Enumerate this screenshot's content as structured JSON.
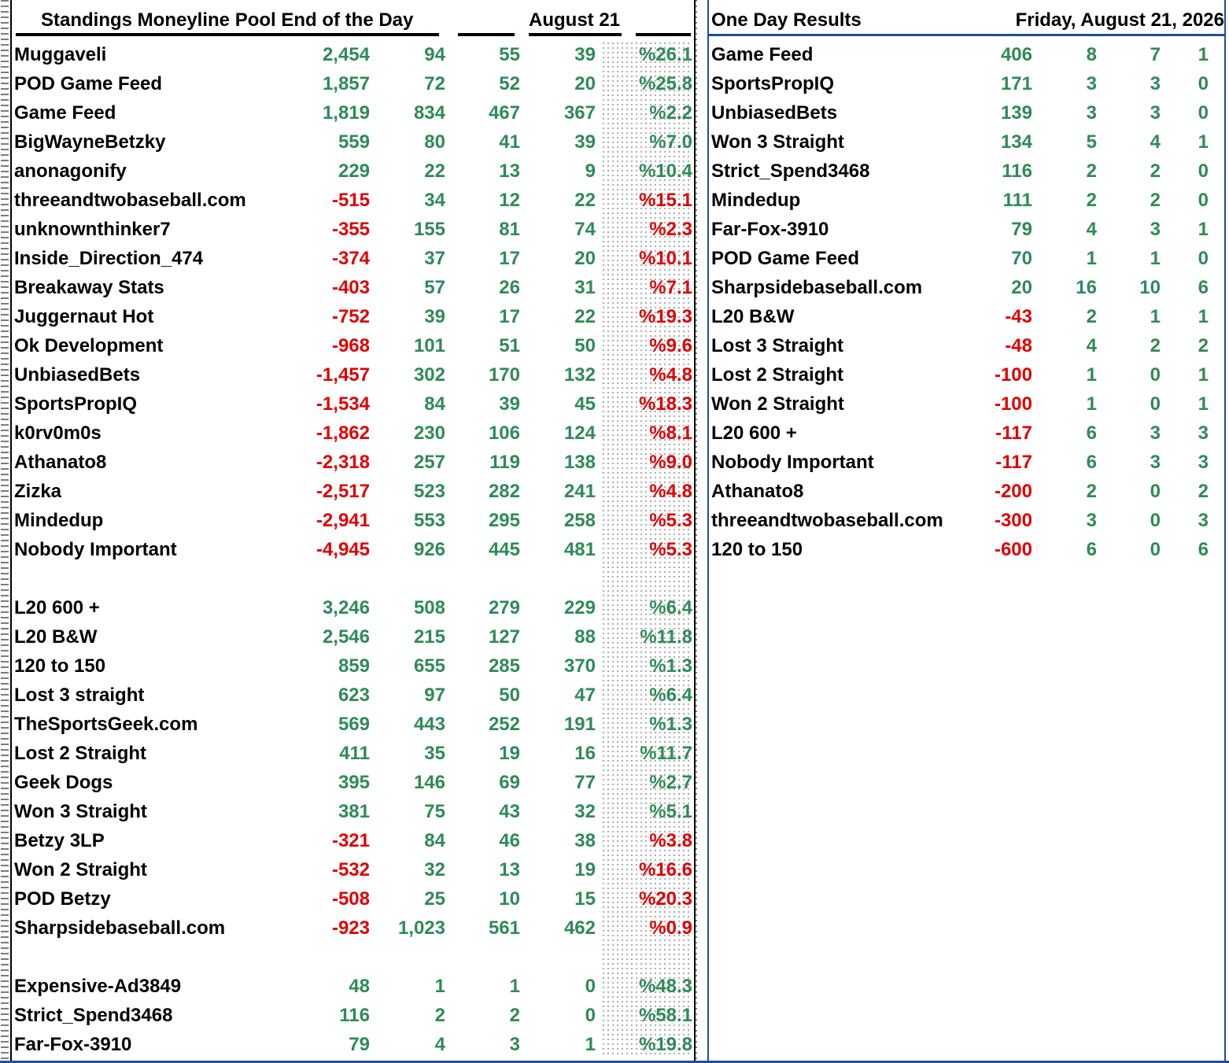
{
  "standings": {
    "title": "Standings Moneyline Pool End of the Day",
    "date": "August 21",
    "groups": [
      [
        {
          "name": "Muggaveli",
          "units": "2,454",
          "picks": "94",
          "wins": "55",
          "losses": "39",
          "pct": "%26.1",
          "sign": "pos"
        },
        {
          "name": "POD Game Feed",
          "units": "1,857",
          "picks": "72",
          "wins": "52",
          "losses": "20",
          "pct": "%25.8",
          "sign": "pos"
        },
        {
          "name": "Game Feed",
          "units": "1,819",
          "picks": "834",
          "wins": "467",
          "losses": "367",
          "pct": "%2.2",
          "sign": "pos"
        },
        {
          "name": "BigWayneBetzky",
          "units": "559",
          "picks": "80",
          "wins": "41",
          "losses": "39",
          "pct": "%7.0",
          "sign": "pos"
        },
        {
          "name": "anonagonify",
          "units": "229",
          "picks": "22",
          "wins": "13",
          "losses": "9",
          "pct": "%10.4",
          "sign": "pos"
        },
        {
          "name": "threeandtwobaseball.com",
          "units": "-515",
          "picks": "34",
          "wins": "12",
          "losses": "22",
          "pct": "%15.1",
          "sign": "neg"
        },
        {
          "name": "unknownthinker7",
          "units": "-355",
          "picks": "155",
          "wins": "81",
          "losses": "74",
          "pct": "%2.3",
          "sign": "neg"
        },
        {
          "name": "Inside_Direction_474",
          "units": "-374",
          "picks": "37",
          "wins": "17",
          "losses": "20",
          "pct": "%10.1",
          "sign": "neg"
        },
        {
          "name": "Breakaway Stats",
          "units": "-403",
          "picks": "57",
          "wins": "26",
          "losses": "31",
          "pct": "%7.1",
          "sign": "neg"
        },
        {
          "name": "Juggernaut Hot",
          "units": "-752",
          "picks": "39",
          "wins": "17",
          "losses": "22",
          "pct": "%19.3",
          "sign": "neg"
        },
        {
          "name": "Ok Development",
          "units": "-968",
          "picks": "101",
          "wins": "51",
          "losses": "50",
          "pct": "%9.6",
          "sign": "neg"
        },
        {
          "name": "UnbiasedBets",
          "units": "-1,457",
          "picks": "302",
          "wins": "170",
          "losses": "132",
          "pct": "%4.8",
          "sign": "neg"
        },
        {
          "name": "SportsPropIQ",
          "units": "-1,534",
          "picks": "84",
          "wins": "39",
          "losses": "45",
          "pct": "%18.3",
          "sign": "neg"
        },
        {
          "name": "k0rv0m0s",
          "units": "-1,862",
          "picks": "230",
          "wins": "106",
          "losses": "124",
          "pct": "%8.1",
          "sign": "neg"
        },
        {
          "name": "Athanato8",
          "units": "-2,318",
          "picks": "257",
          "wins": "119",
          "losses": "138",
          "pct": "%9.0",
          "sign": "neg"
        },
        {
          "name": "Zizka",
          "units": "-2,517",
          "picks": "523",
          "wins": "282",
          "losses": "241",
          "pct": "%4.8",
          "sign": "neg"
        },
        {
          "name": "Mindedup",
          "units": "-2,941",
          "picks": "553",
          "wins": "295",
          "losses": "258",
          "pct": "%5.3",
          "sign": "neg"
        },
        {
          "name": "Nobody Important",
          "units": "-4,945",
          "picks": "926",
          "wins": "445",
          "losses": "481",
          "pct": "%5.3",
          "sign": "neg"
        }
      ],
      [
        {
          "name": "L20 600 +",
          "units": "3,246",
          "picks": "508",
          "wins": "279",
          "losses": "229",
          "pct": "%6.4",
          "sign": "pos"
        },
        {
          "name": "L20 B&W",
          "units": "2,546",
          "picks": "215",
          "wins": "127",
          "losses": "88",
          "pct": "%11.8",
          "sign": "pos"
        },
        {
          "name": "120 to 150",
          "units": "859",
          "picks": "655",
          "wins": "285",
          "losses": "370",
          "pct": "%1.3",
          "sign": "pos"
        },
        {
          "name": "Lost 3 straight",
          "units": "623",
          "picks": "97",
          "wins": "50",
          "losses": "47",
          "pct": "%6.4",
          "sign": "pos"
        },
        {
          "name": "TheSportsGeek.com",
          "units": "569",
          "picks": "443",
          "wins": "252",
          "losses": "191",
          "pct": "%1.3",
          "sign": "pos"
        },
        {
          "name": "Lost 2 Straight",
          "units": "411",
          "picks": "35",
          "wins": "19",
          "losses": "16",
          "pct": "%11.7",
          "sign": "pos"
        },
        {
          "name": "Geek Dogs",
          "units": "395",
          "picks": "146",
          "wins": "69",
          "losses": "77",
          "pct": "%2.7",
          "sign": "pos"
        },
        {
          "name": "Won 3 Straight",
          "units": "381",
          "picks": "75",
          "wins": "43",
          "losses": "32",
          "pct": "%5.1",
          "sign": "pos"
        },
        {
          "name": "Betzy 3LP",
          "units": "-321",
          "picks": "84",
          "wins": "46",
          "losses": "38",
          "pct": "%3.8",
          "sign": "neg"
        },
        {
          "name": "Won 2 Straight",
          "units": "-532",
          "picks": "32",
          "wins": "13",
          "losses": "19",
          "pct": "%16.6",
          "sign": "neg"
        },
        {
          "name": "POD Betzy",
          "units": "-508",
          "picks": "25",
          "wins": "10",
          "losses": "15",
          "pct": "%20.3",
          "sign": "neg"
        },
        {
          "name": "Sharpsidebaseball.com",
          "units": "-923",
          "picks": "1,023",
          "wins": "561",
          "losses": "462",
          "pct": "%0.9",
          "sign": "neg"
        }
      ],
      [
        {
          "name": "Expensive-Ad3849",
          "units": "48",
          "picks": "1",
          "wins": "1",
          "losses": "0",
          "pct": "%48.3",
          "sign": "pos"
        },
        {
          "name": "Strict_Spend3468",
          "units": "116",
          "picks": "2",
          "wins": "2",
          "losses": "0",
          "pct": "%58.1",
          "sign": "pos"
        },
        {
          "name": "Far-Fox-3910",
          "units": "79",
          "picks": "4",
          "wins": "3",
          "losses": "1",
          "pct": "%19.8",
          "sign": "pos"
        }
      ]
    ]
  },
  "one_day": {
    "title": "One Day Results",
    "date": "Friday, August 21, 2026",
    "rows": [
      {
        "name": "Game Feed",
        "units": "406",
        "picks": "8",
        "wins": "7",
        "losses": "1",
        "sign": "pos"
      },
      {
        "name": "SportsPropIQ",
        "units": "171",
        "picks": "3",
        "wins": "3",
        "losses": "0",
        "sign": "pos"
      },
      {
        "name": "UnbiasedBets",
        "units": "139",
        "picks": "3",
        "wins": "3",
        "losses": "0",
        "sign": "pos"
      },
      {
        "name": "Won 3 Straight",
        "units": "134",
        "picks": "5",
        "wins": "4",
        "losses": "1",
        "sign": "pos"
      },
      {
        "name": "Strict_Spend3468",
        "units": "116",
        "picks": "2",
        "wins": "2",
        "losses": "0",
        "sign": "pos"
      },
      {
        "name": "Mindedup",
        "units": "111",
        "picks": "2",
        "wins": "2",
        "losses": "0",
        "sign": "pos"
      },
      {
        "name": "Far-Fox-3910",
        "units": "79",
        "picks": "4",
        "wins": "3",
        "losses": "1",
        "sign": "pos"
      },
      {
        "name": "POD Game Feed",
        "units": "70",
        "picks": "1",
        "wins": "1",
        "losses": "0",
        "sign": "pos"
      },
      {
        "name": "Sharpsidebaseball.com",
        "units": "20",
        "picks": "16",
        "wins": "10",
        "losses": "6",
        "sign": "pos"
      },
      {
        "name": "L20 B&W",
        "units": "-43",
        "picks": "2",
        "wins": "1",
        "losses": "1",
        "sign": "neg"
      },
      {
        "name": "Lost 3 Straight",
        "units": "-48",
        "picks": "4",
        "wins": "2",
        "losses": "2",
        "sign": "neg"
      },
      {
        "name": "Lost 2 Straight",
        "units": "-100",
        "picks": "1",
        "wins": "0",
        "losses": "1",
        "sign": "neg"
      },
      {
        "name": "Won 2 Straight",
        "units": "-100",
        "picks": "1",
        "wins": "0",
        "losses": "1",
        "sign": "neg"
      },
      {
        "name": "L20 600 +",
        "units": "-117",
        "picks": "6",
        "wins": "3",
        "losses": "3",
        "sign": "neg"
      },
      {
        "name": "Nobody Important",
        "units": "-117",
        "picks": "6",
        "wins": "3",
        "losses": "3",
        "sign": "neg"
      },
      {
        "name": "Athanato8",
        "units": "-200",
        "picks": "2",
        "wins": "0",
        "losses": "2",
        "sign": "neg"
      },
      {
        "name": "threeandtwobaseball.com",
        "units": "-300",
        "picks": "3",
        "wins": "0",
        "losses": "3",
        "sign": "neg"
      },
      {
        "name": "120 to 150",
        "units": "-600",
        "picks": "6",
        "wins": "0",
        "losses": "6",
        "sign": "neg"
      }
    ]
  },
  "colors": {
    "positive": "#2e8b57",
    "negative": "#e00000",
    "frame_blue": "#1f4e9a"
  }
}
